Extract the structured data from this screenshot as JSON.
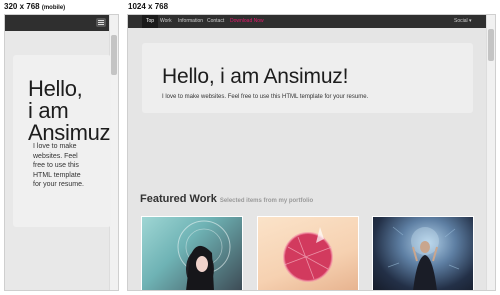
{
  "captions": {
    "mobile": "320 x 768",
    "mobile_suffix": "(mobile)",
    "desktop": "1024 x 768"
  },
  "mobile": {
    "menu_icon": "hamburger-menu-icon",
    "hero_title": "Hello,\ni am\nAnsimuz",
    "hero_text": "I love to make websites. Feel free to use this HTML template for your resume."
  },
  "desktop": {
    "nav": {
      "items": [
        "Top",
        "Work",
        "Information",
        "Contact",
        "Download Now"
      ],
      "social": "Social ▾",
      "active": "Top"
    },
    "hero_title": "Hello, i am Ansimuz!",
    "hero_text": "I love to make websites. Feel free to use this HTML template for your resume.",
    "featured_title": "Featured Work",
    "featured_subtitle": "Selected items from my portfolio",
    "portfolio_thumbnails": [
      "woman-portrait-art",
      "pink-circle-art",
      "figure-dark-art"
    ]
  },
  "colors": {
    "nav_bg": "#2f2f2f",
    "accent": "#e2186b",
    "page_bg": "#e5e5e5"
  }
}
